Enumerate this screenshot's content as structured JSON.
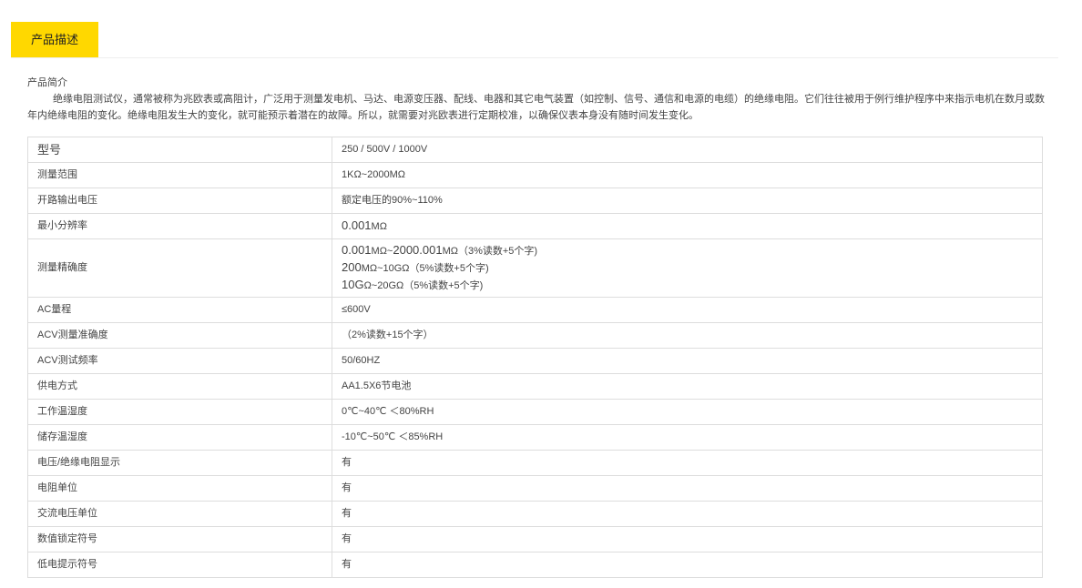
{
  "tabs": {
    "active_label": "产品描述"
  },
  "intro": {
    "title": "产品简介",
    "body": "绝缘电阻测试仪，通常被称为兆欧表或高阻计，广泛用于测量发电机、马达、电源变压器、配线、电器和其它电气装置（如控制、信号、通信和电源的电缆）的绝缘电阻。它们往往被用于例行维护程序中来指示电机在数月或数年内绝缘电阻的变化。绝缘电阻发生大的变化，就可能预示着潜在的故障。所以，就需要对兆欧表进行定期校准，以确保仪表本身没有随时间发生变化。"
  },
  "specs": {
    "model": {
      "label": "型号",
      "value": "250 / 500V / 1000V"
    },
    "range": {
      "label": "测量范围",
      "value": "1KΩ~2000MΩ"
    },
    "open_voltage": {
      "label": "开路输出电压",
      "value": "额定电压的90%~110%"
    },
    "resolution": {
      "label": "最小分辨率",
      "value_big": "0.001",
      "value_unit": "MΩ"
    },
    "accuracy": {
      "label": "测量精确度",
      "lines": [
        {
          "big": "0.001",
          "rest": "MΩ~",
          "big2": "2000.001",
          "rest2": "MΩ（3%读数+5个字)"
        },
        {
          "big": "200",
          "rest": "MΩ~10GΩ（5%读数+5个字)"
        },
        {
          "big": "10G",
          "rest": "Ω~20GΩ（5%读数+5个字)"
        }
      ]
    },
    "ac_range": {
      "label": "AC量程",
      "value": "≤600V"
    },
    "acv_accuracy": {
      "label": "ACV测量准确度",
      "value": "（2%读数+15个字）"
    },
    "acv_freq": {
      "label": "ACV测试频率",
      "value": "50/60HZ"
    },
    "power": {
      "label": "供电方式",
      "value": "AA1.5X6节电池"
    },
    "work_temp": {
      "label": "工作温湿度",
      "value": "0℃~40℃ ＜80%RH"
    },
    "store_temp": {
      "label": "储存温湿度",
      "value": "-10℃~50℃ ＜85%RH"
    },
    "display": {
      "label": "电压/绝缘电阻显示",
      "value": "有"
    },
    "res_unit": {
      "label": "电阻单位",
      "value": "有"
    },
    "ac_unit": {
      "label": "交流电压单位",
      "value": "有"
    },
    "hold": {
      "label": "数值锁定符号",
      "value": "有"
    },
    "low_batt": {
      "label": "低电提示符号",
      "value": "有"
    }
  }
}
